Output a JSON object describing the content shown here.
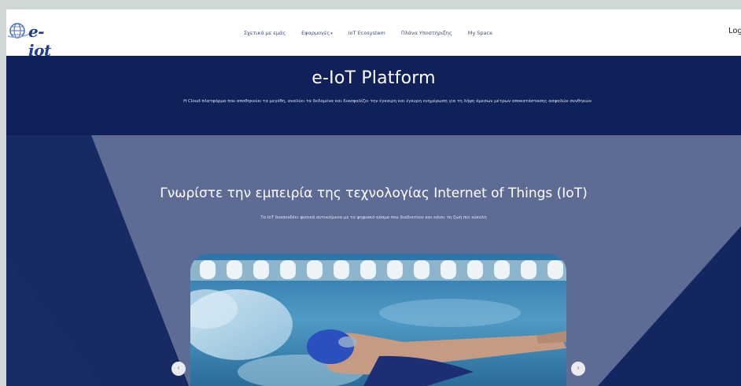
{
  "header": {
    "logo_text": "e-iot",
    "nav": [
      {
        "label": "Σχετικά με εμάς"
      },
      {
        "label": "Εφαρμογές",
        "has_dropdown": true
      },
      {
        "label": "IoT Ecosystem"
      },
      {
        "label": "Πλάνα Υποστήριξης"
      },
      {
        "label": "My Space"
      }
    ],
    "login_label": "Login"
  },
  "hero": {
    "title": "e-IoT Platform",
    "description": "Η Cloud πλατφόρμα που αποθηκεύει τα μεγέθη, αναλύει τα δεδομένα και διασφαλίζει την έγκαιρη και έγκυρη ενημέρωση για τη λήψη άμεσων μέτρων αποκατάστασης ασφαλών συνθηκών"
  },
  "section": {
    "title": "Γνωρίστε την εμπειρία της τεχνολογίας Internet of Things (IoT)",
    "subtitle": "Το IoT διασυνδέει φυσικά αντικείμενα με το ψηφιακό κόσμο που διαδικτύου και κάνει τη ζωή πιο εύκολη"
  },
  "carousel": {
    "prev_icon": "chevron-left-icon",
    "next_icon": "chevron-right-icon",
    "prev_glyph": "‹",
    "next_glyph": "›"
  },
  "colors": {
    "navy": "#13235a",
    "slate_panel": "#5e6b94",
    "logo_blue": "#1c3d8c"
  }
}
